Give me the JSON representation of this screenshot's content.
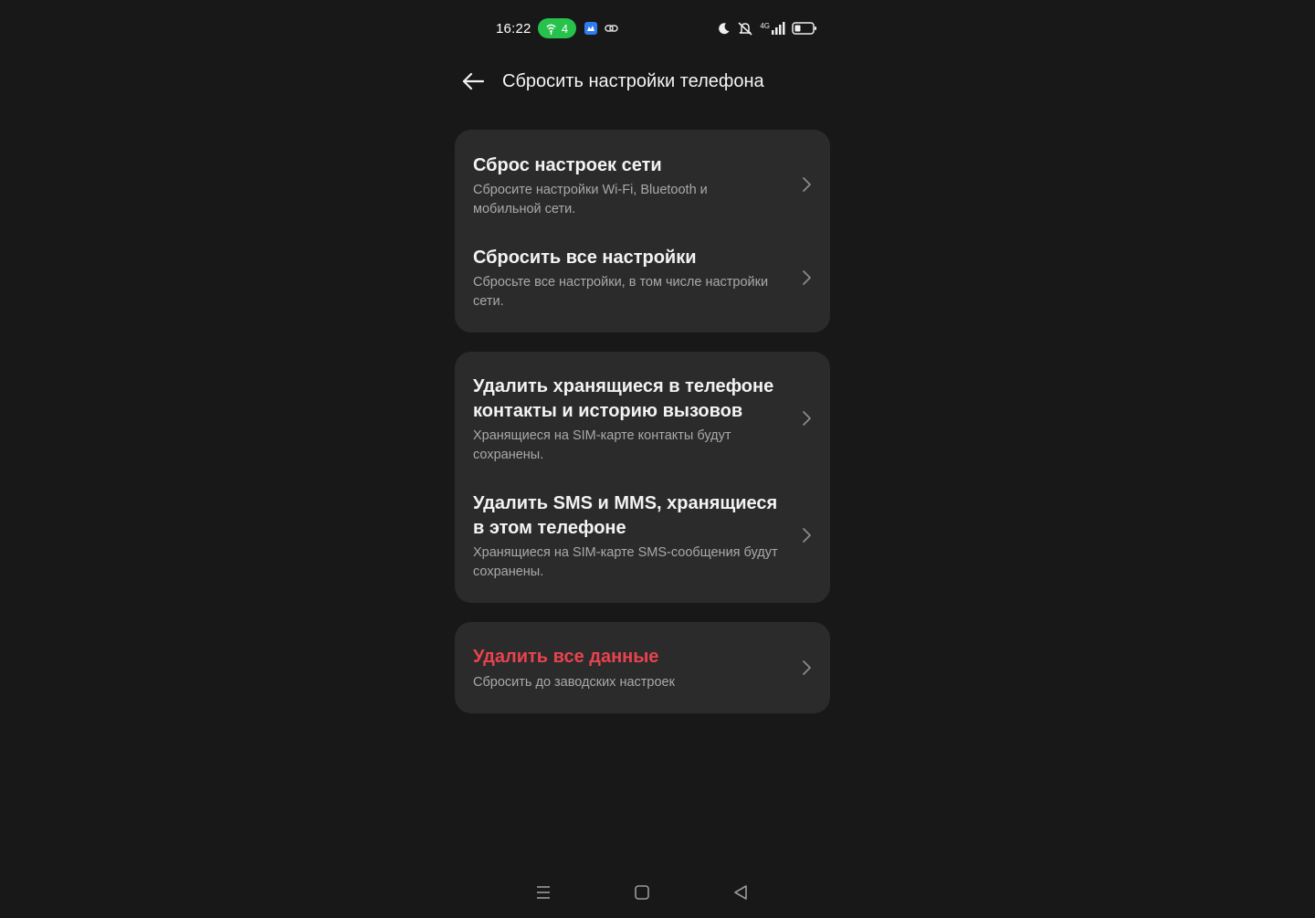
{
  "status_bar": {
    "time": "16:22",
    "hotspot_count": "4",
    "icons": [
      "hotspot-icon",
      "app-notification-icon",
      "link-icon",
      "moon-icon",
      "mute-icon",
      "signal-icon",
      "battery-icon"
    ],
    "network_type": "4G"
  },
  "header": {
    "title": "Сбросить настройки телефона",
    "back_icon": "arrow-left-icon"
  },
  "groups": [
    {
      "items": [
        {
          "title": "Сброс настроек сети",
          "subtitle": "Сбросите настройки Wi-Fi, Bluetooth и мобильной сети."
        },
        {
          "title": "Сбросить все настройки",
          "subtitle": "Сбросьте все настройки, в том числе настройки сети."
        }
      ]
    },
    {
      "items": [
        {
          "title": "Удалить хранящиеся в телефоне контакты и историю вызовов",
          "subtitle": "Хранящиеся на SIM-карте контакты будут сохранены."
        },
        {
          "title": "Удалить SMS и MMS, хранящиеся в этом телефоне",
          "subtitle": "Хранящиеся на SIM-карте SMS-сообщения будут сохранены."
        }
      ]
    },
    {
      "items": [
        {
          "title": "Удалить все данные",
          "subtitle": "Сбросить до заводских настроек",
          "danger": true
        }
      ]
    }
  ],
  "colors": {
    "background": "#181818",
    "card": "#2b2b2b",
    "danger": "#e8434f",
    "hotspot": "#27c24c",
    "subtitle": "#a9a9a9"
  },
  "nav_bar": {
    "icons": [
      "menu-icon",
      "home-icon",
      "back-triangle-icon"
    ]
  }
}
